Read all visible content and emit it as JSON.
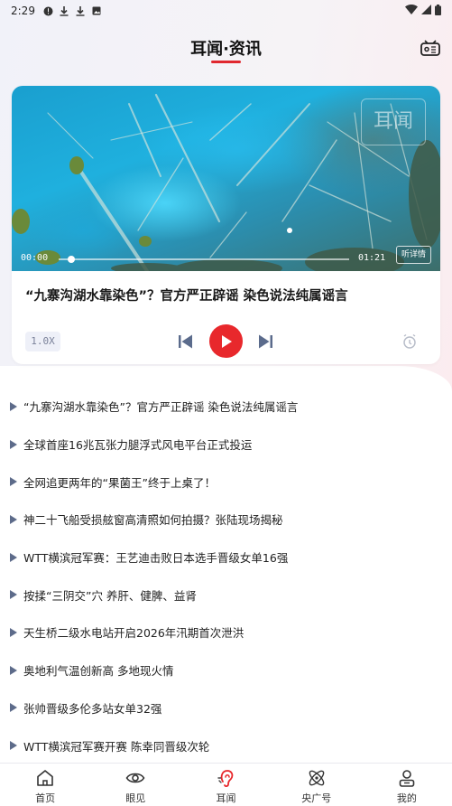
{
  "status_bar": {
    "time": "2:29",
    "left_icons": [
      "info-icon",
      "download-icon",
      "download-icon",
      "photo-icon"
    ],
    "right_icons": [
      "wifi-icon",
      "signal-icon",
      "battery-icon"
    ]
  },
  "header": {
    "title": "耳闻·资讯",
    "radio_icon": "radio-icon"
  },
  "player": {
    "current_time": "00:00",
    "total_time": "01:21",
    "progress": 0.0,
    "detail_button": "听详情",
    "title": "“九寨沟湖水靠染色”？官方严正辟谣  染色说法纯属谣言",
    "speed": "1.0X",
    "controls": [
      "prev-icon",
      "play-icon",
      "next-icon",
      "timer-icon"
    ]
  },
  "news": [
    "“九寨沟湖水靠染色”？官方严正辟谣  染色说法纯属谣言",
    "全球首座16兆瓦张力腿浮式风电平台正式投运",
    "全网追更两年的“果菌王”终于上桌了！",
    "神二十飞船受损舷窗高清照如何拍摄？张陆现场揭秘",
    "WTT横滨冠军赛：王艺迪击败日本选手晋级女单16强",
    "按揉“三阴交”穴  养肝、健脾、益肾",
    "天生桥二级水电站开启2026年汛期首次泄洪",
    "奥地利气温创新高  多地现火情",
    "张帅晋级多伦多站女单32强",
    "WTT横滨冠军赛开赛  陈幸同晋级次轮"
  ],
  "tabs": [
    {
      "label": "首页",
      "icon": "home-icon"
    },
    {
      "label": "眼见",
      "icon": "eye-icon"
    },
    {
      "label": "耳闻",
      "icon": "ear-icon",
      "active": true
    },
    {
      "label": "央广号",
      "icon": "atom-icon"
    },
    {
      "label": "我的",
      "icon": "profile-icon"
    }
  ],
  "colors": {
    "accent": "#e8282c",
    "list_marker": "#5d6b8a"
  }
}
